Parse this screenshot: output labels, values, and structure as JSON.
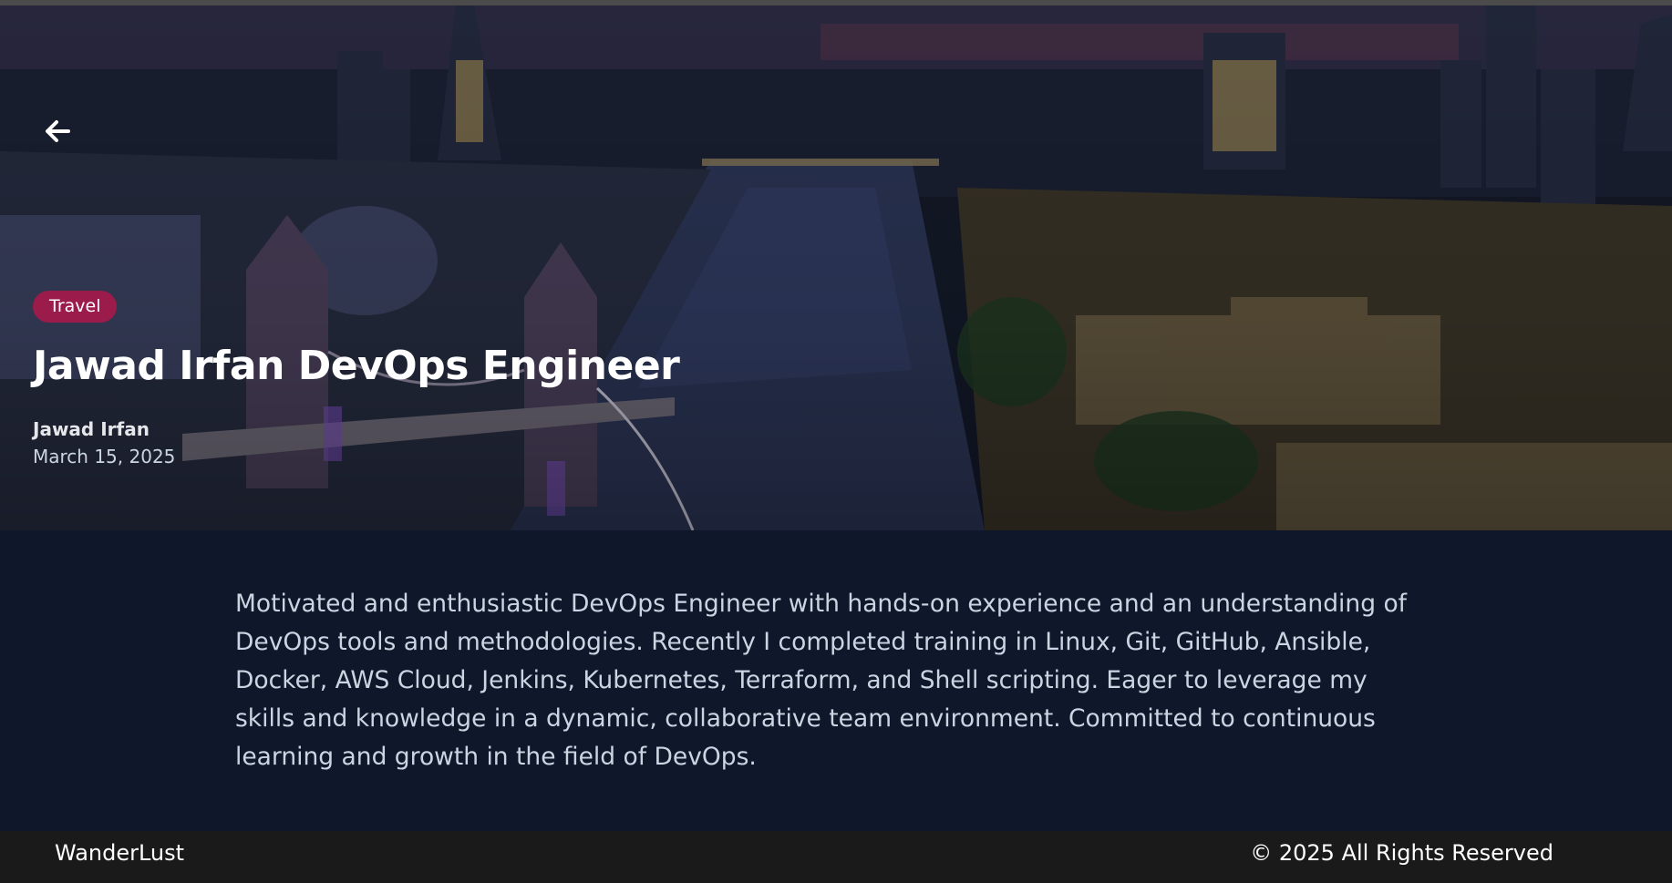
{
  "hero": {
    "category_tag": "Travel",
    "title": "Jawad Irfan DevOps Engineer",
    "author": "Jawad Irfan",
    "date": "March 15, 2025",
    "background": "night city skyline aerial photo with river and bridge"
  },
  "icons": {
    "back": "arrow-left-icon"
  },
  "article": {
    "body": "Motivated and enthusiastic DevOps Engineer with hands-on experience and an understanding of DevOps tools and methodologies. Recently I completed training in Linux, Git, GitHub, Ansible, Docker, AWS Cloud, Jenkins, Kubernetes, Terraform, and Shell scripting. Eager to leverage my skills and knowledge in a dynamic, collaborative team environment. Committed to continuous learning and growth in the field of DevOps."
  },
  "footer": {
    "brand": "WanderLust",
    "copyright": "©  2025 All Rights Reserved"
  },
  "colors": {
    "tag_background": "#9b1b4a",
    "page_background": "#0f172a",
    "footer_background": "#1a1a1a"
  }
}
